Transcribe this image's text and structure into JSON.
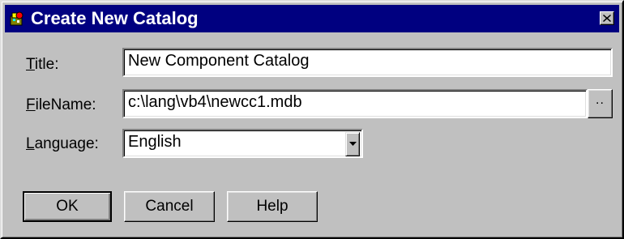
{
  "window": {
    "title": "Create New Catalog"
  },
  "form": {
    "title_label": "Title:",
    "title_label_access": "T",
    "title_label_rest": "itle:",
    "title_value": "New Component Catalog",
    "filename_label": "FileName:",
    "filename_label_access": "F",
    "filename_label_rest": "ileName:",
    "filename_value": "c:\\lang\\vb4\\newcc1.mdb",
    "browse_label": "..",
    "language_label": "Language:",
    "language_label_access": "L",
    "language_label_rest": "anguage:",
    "language_value": "English"
  },
  "buttons": {
    "ok": "OK",
    "cancel": "Cancel",
    "help": "Help"
  },
  "icons": {
    "app": "catalog-app-icon",
    "close": "close-icon",
    "dropdown": "down-arrow-icon"
  },
  "colors": {
    "titlebar": "#000080",
    "face": "#c0c0c0",
    "field": "#ffffff"
  }
}
